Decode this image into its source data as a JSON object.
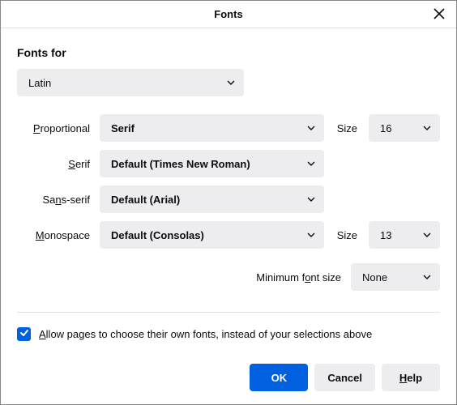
{
  "title": "Fonts",
  "heading": "Fonts for",
  "language": "Latin",
  "rows": {
    "proportional": {
      "label": "Proportional",
      "value": "Serif",
      "sizeLabel": "Size",
      "size": "16"
    },
    "serif": {
      "label": "Serif",
      "value": "Default (Times New Roman)"
    },
    "sansserif": {
      "label": "Sans-serif",
      "value": "Default (Arial)"
    },
    "monospace": {
      "label": "Monospace",
      "value": "Default (Consolas)",
      "sizeLabel": "Size",
      "size": "13"
    }
  },
  "minimum": {
    "label": "Minimum font size",
    "value": "None"
  },
  "checkbox": {
    "checked": true,
    "label_pre": "A",
    "label_rest": "llow pages to choose their own fonts, instead of your selections above"
  },
  "buttons": {
    "ok": "OK",
    "cancel": "Cancel",
    "help_pre": "H",
    "help_rest": "elp"
  }
}
